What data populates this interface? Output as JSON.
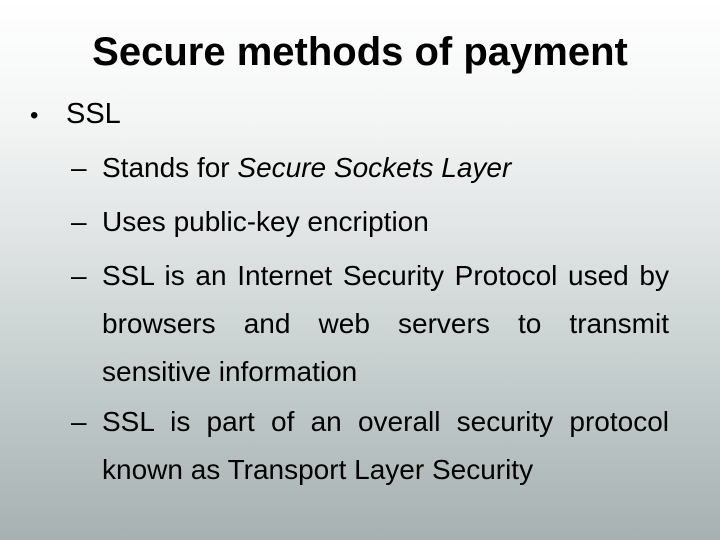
{
  "slide": {
    "title": "Secure methods of payment",
    "bullet": {
      "marker": "•",
      "label": "SSL",
      "subpoints": [
        {
          "marker": "–",
          "text_before": "Stands for ",
          "text_italic": "Secure Sockets Layer"
        },
        {
          "marker": "–",
          "text": "Uses public-key encription"
        },
        {
          "marker": "–",
          "text": "SSL is an Internet Security Protocol used by browsers and web servers to transmit sensitive information"
        },
        {
          "marker": "–",
          "text": "SSL is part of an overall security protocol known as Transport Layer Security"
        }
      ]
    }
  },
  "colors": {
    "background_top": "#ffffff",
    "background_bottom": "#a7b1b1",
    "text": "#000000"
  }
}
